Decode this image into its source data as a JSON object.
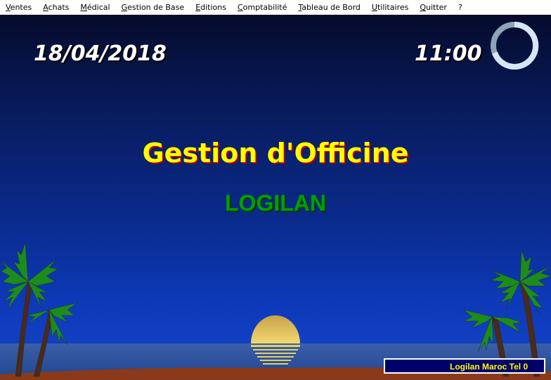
{
  "menu": {
    "items": [
      {
        "label": "Ventes",
        "mnemonic": "V",
        "rest": "entes"
      },
      {
        "label": "Achats",
        "mnemonic": "A",
        "rest": "chats"
      },
      {
        "label": "Médical",
        "mnemonic": "M",
        "rest": "édical"
      },
      {
        "label": "Gestion de Base",
        "mnemonic": "G",
        "rest": "estion de Base"
      },
      {
        "label": "Editions",
        "mnemonic": "E",
        "rest": "ditions"
      },
      {
        "label": "Comptabilité",
        "mnemonic": "C",
        "rest": "omptabilité"
      },
      {
        "label": "Tableau de Bord",
        "mnemonic": "T",
        "rest": "ableau de Bord"
      },
      {
        "label": "Utilitaires",
        "mnemonic": "U",
        "rest": "tilitaires"
      },
      {
        "label": "Quitter",
        "mnemonic": "Q",
        "rest": "uitter"
      },
      {
        "label": "?",
        "mnemonic": "",
        "rest": "?"
      }
    ]
  },
  "header": {
    "date": "18/04/2018",
    "time": "11:00"
  },
  "splash": {
    "title": "Gestion d'Officine",
    "subtitle": "LOGILAN"
  },
  "ticker": {
    "text": "Logilan Maroc Tel 0"
  },
  "colors": {
    "title": "#ffff00",
    "subtitle": "#00a000",
    "ticker_bg": "#00006a",
    "ticker_text": "#ffff00"
  }
}
